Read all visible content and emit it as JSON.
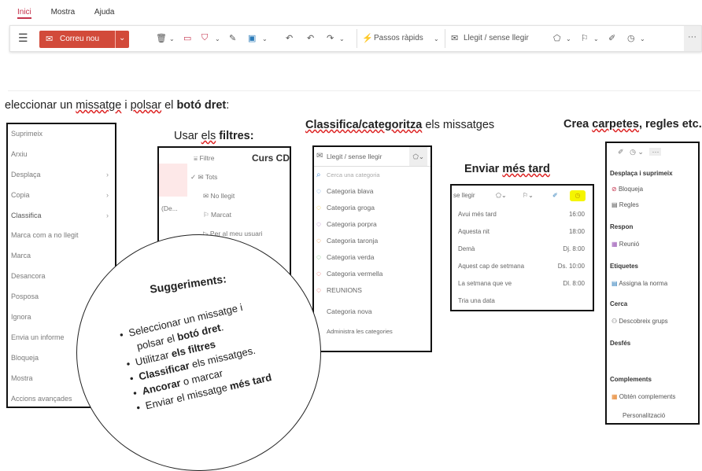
{
  "ribbon": {
    "tabs": [
      "Inici",
      "Mostra",
      "Ajuda"
    ],
    "new_mail": "Correu nou",
    "quick_steps": "Passos ràpids",
    "read_unread": "Llegit / sense llegir",
    "more": "···"
  },
  "headings": {
    "h1_pre": "eleccionar un ",
    "h1_u1": "missatge",
    "h1_mid": " i ",
    "h1_u2": "polsar",
    "h1_mid2": " el ",
    "h1_bold": "botó dret",
    "h1_end": ":",
    "h2_pre": "Usar ",
    "h2_u": "els",
    "h2_bold": " filtres:",
    "h3_u": "Classifica/categoritza",
    "h3_end": " els missatges",
    "h4_pre": "Enviar ",
    "h4_u": "més tard",
    "h5_pre": "Crea ",
    "h5_u": "carpetes",
    "h5_end": ", regles etc."
  },
  "context_menu": [
    "Suprimeix",
    "Arxiu",
    "Desplaça",
    "Copia",
    "Classifica",
    "Marca com a no llegit",
    "Marca",
    "Desancora",
    "Posposa",
    "Ignora",
    "Envia un informe",
    "Bloqueja",
    "Mostra",
    "Accions avançades"
  ],
  "filter_panel": {
    "filtre": "Filtre",
    "course": "Curs CD",
    "items": [
      "Tots",
      "No llegit",
      "Marcat",
      "Per al meu usuari"
    ],
    "side_text": "(De..."
  },
  "categories": {
    "header": "Llegit / sense llegir",
    "search": "Cerca una categoria",
    "items": [
      {
        "label": "Categoria blava",
        "color": "#4a90d9"
      },
      {
        "label": "Categoria groga",
        "color": "#f0c020"
      },
      {
        "label": "Categoria porpra",
        "color": "#9b59b6"
      },
      {
        "label": "Categoria taronja",
        "color": "#e67e22"
      },
      {
        "label": "Categoria verda",
        "color": "#4caf50"
      },
      {
        "label": "Categoria vermella",
        "color": "#e53935"
      },
      {
        "label": "REUNIONS",
        "color": "#e53935"
      }
    ],
    "new": "Categoria nova",
    "manage": "Administra les categories"
  },
  "send_later": {
    "header": "se llegir",
    "rows": [
      {
        "label": "Avui més tard",
        "time": "16:00"
      },
      {
        "label": "Aquesta nit",
        "time": "18:00"
      },
      {
        "label": "Demà",
        "time": "Dj. 8:00"
      },
      {
        "label": "Aquest cap de setmana",
        "time": "Ds. 10:00"
      },
      {
        "label": "La setmana que ve",
        "time": "Dl. 8:00"
      },
      {
        "label": "Tria una data",
        "time": ""
      }
    ]
  },
  "right_panel": {
    "section1": "Desplaça i suprimeix",
    "block": "Bloqueja",
    "rules": "Regles",
    "section2": "Respon",
    "meet": "Reunió",
    "section3": "Etiquetes",
    "assign": "Assigna la norma",
    "section4": "Cerca",
    "groups": "Descobreix grups",
    "section5": "Desfés",
    "section6": "Complements",
    "addins": "Obtén complements",
    "personal": "Personalització"
  },
  "suggestions": {
    "title": "Suggeriments:",
    "b1a": "Seleccionar un missatge i",
    "b1b_pre": "polsar el ",
    "b1b_bold": "botó dret",
    "b1b_end": ".",
    "b2_pre": "Utilitzar ",
    "b2_bold": "els filtres",
    "b3_bold": "Classificar",
    "b3_end": " els missatges.",
    "b4_bold": "Ancorar",
    "b4_end": " o marcar",
    "b5_pre": "Enviar el missatge ",
    "b5_bold": "més tard"
  },
  "colors": {
    "accent": "#d24a3a",
    "highlight": "#f5f500"
  }
}
